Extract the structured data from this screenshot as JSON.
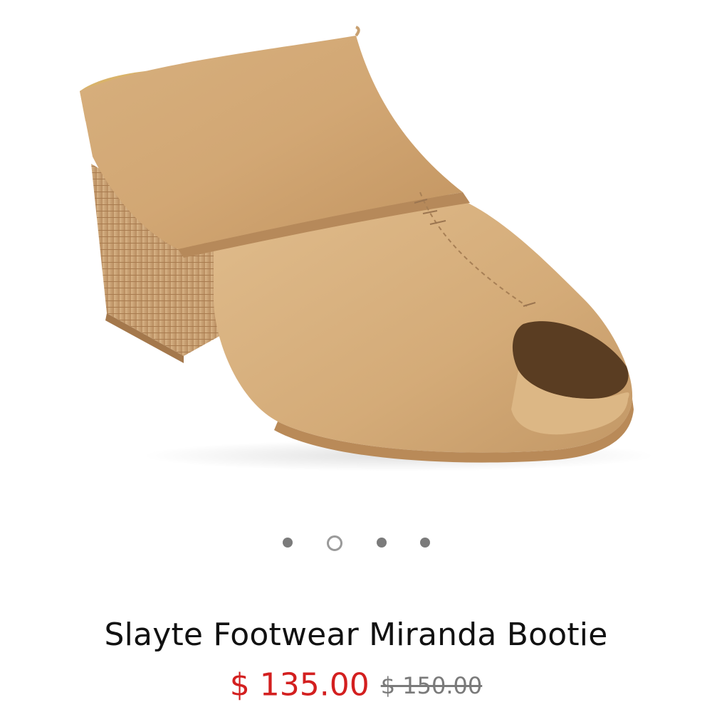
{
  "product": {
    "title": "Slayte Footwear Miranda Bootie",
    "sale_price": "$ 135.00",
    "original_price": "$ 150.00",
    "image": "tan-leather-peep-toe-mule"
  },
  "gallery": {
    "total_images": 4,
    "active_index": 2
  },
  "colors": {
    "sale_price": "#d31f1f",
    "original_price": "#7a7a7a",
    "dot": "#7b7b7b"
  }
}
